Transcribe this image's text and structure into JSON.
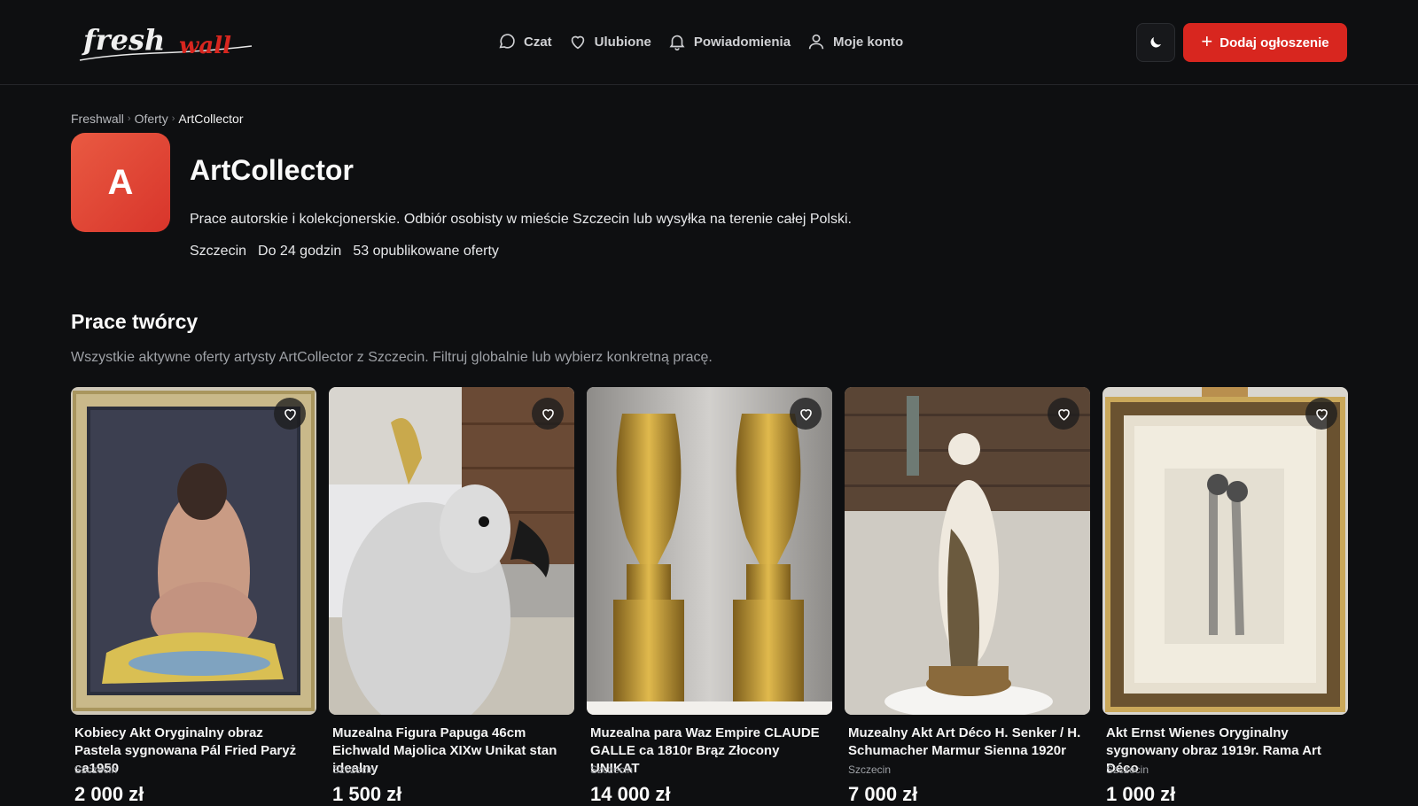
{
  "header": {
    "logo_word1": "fresh",
    "logo_word2": "wall",
    "nav": [
      {
        "label": "Czat",
        "icon": "chat-bubble-icon"
      },
      {
        "label": "Ulubione",
        "icon": "heart-icon"
      },
      {
        "label": "Powiadomienia",
        "icon": "bell-icon"
      },
      {
        "label": "Moje konto",
        "icon": "user-icon"
      }
    ],
    "theme_toggle_icon": "moon-icon",
    "add_button_label": "Dodaj ogłoszenie",
    "colors": {
      "accent": "#d8261f",
      "background": "#0e0f11"
    }
  },
  "breadcrumb": [
    "Freshwall",
    "Oferty",
    "ArtCollector"
  ],
  "profile": {
    "avatar_letter": "A",
    "name": "ArtCollector",
    "description": "Prace autorskie i kolekcjonerskie. Odbiór osobisty w mieście Szczecin lub wysyłka na terenie całej Polski.",
    "city": "Szczecin",
    "response_time": "Do 24 godzin",
    "offers_count": "53 opublikowane oferty"
  },
  "section": {
    "title": "Prace twórcy",
    "subtitle": "Wszystkie aktywne oferty artysty ArtCollector z Szczecin. Filtruj globalnie lub wybierz konkretną pracę."
  },
  "listings": [
    {
      "title": "Kobiecy Akt Oryginalny obraz Pastela sygnowana Pál Fried Paryż ca1950",
      "city": "Szczecin",
      "price": "2 000 zł"
    },
    {
      "title": "Muzealna Figura Papuga 46cm Eichwald Majolica XIXw Unikat stan idealny",
      "city": "Szczecin",
      "price": "1 500 zł"
    },
    {
      "title": "Muzealna para Waz Empire CLAUDE GALLE ca 1810r Brąz Złocony UNIKAT",
      "city": "Szczecin",
      "price": "14 000 zł"
    },
    {
      "title": "Muzealny Akt Art Déco H. Senker / H. Schumacher Marmur Sienna 1920r",
      "city": "Szczecin",
      "price": "7 000 zł"
    },
    {
      "title": "Akt Ernst Wienes Oryginalny sygnowany obraz 1919r. Rama Art Déco",
      "city": "Szczecin",
      "price": "1 000 zł"
    }
  ]
}
